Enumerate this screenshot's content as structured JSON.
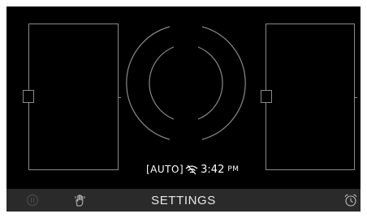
{
  "status": {
    "auto_label": "[AUTO]",
    "time": "3:42",
    "ampm": "PM"
  },
  "bottom_bar": {
    "settings_label": "SETTINGS",
    "icons": {
      "left": "power-icon",
      "hand": "hand-touch-icon",
      "right": "alarm-clock-icon"
    }
  },
  "colors": {
    "background": "#000000",
    "outline": "#8a8a8a",
    "bar": "#2a2a2a",
    "text": "#ffffff"
  }
}
